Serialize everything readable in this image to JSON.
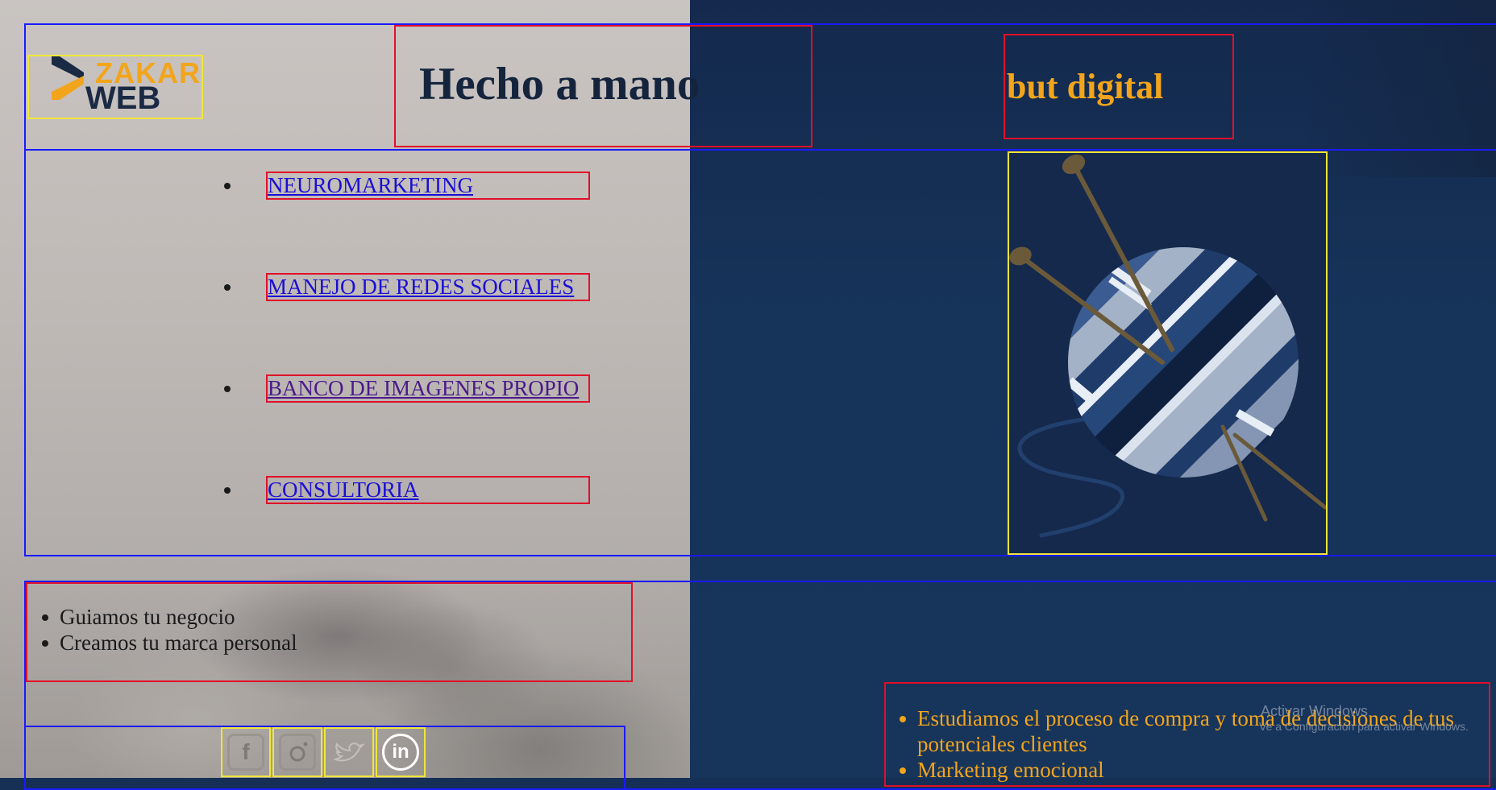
{
  "colors": {
    "accent": "#f2a51c",
    "title": "#15243d",
    "link": "#1a0ed6",
    "visited_link": "#4b1a8a",
    "right_panel": "#152f55"
  },
  "header": {
    "logo": {
      "word1": "ZAKAR",
      "word2": "WEB"
    },
    "title": "Hecho a mano",
    "subtitle": "but digital"
  },
  "nav": {
    "items": [
      {
        "label": "NEUROMARKETING"
      },
      {
        "label": "MANEJO DE REDES SOCIALES"
      },
      {
        "label": "BANCO DE IMAGENES PROPIO"
      },
      {
        "label": "CONSULTORIA"
      }
    ]
  },
  "left_list": {
    "items": [
      "Guiamos tu negocio",
      "Creamos tu marca personal"
    ]
  },
  "social": {
    "icons": [
      "facebook-icon",
      "instagram-icon",
      "twitter-icon",
      "linkedin-icon"
    ],
    "linkedin_text": "in"
  },
  "right_list": {
    "items": [
      "Estudiamos el proceso de compra y toma de decisiones de tus potenciales clientes",
      "Marketing emocional"
    ]
  },
  "watermark": {
    "line1": "Activar Windows",
    "line2": "Ve a Configuración para activar Windows."
  }
}
